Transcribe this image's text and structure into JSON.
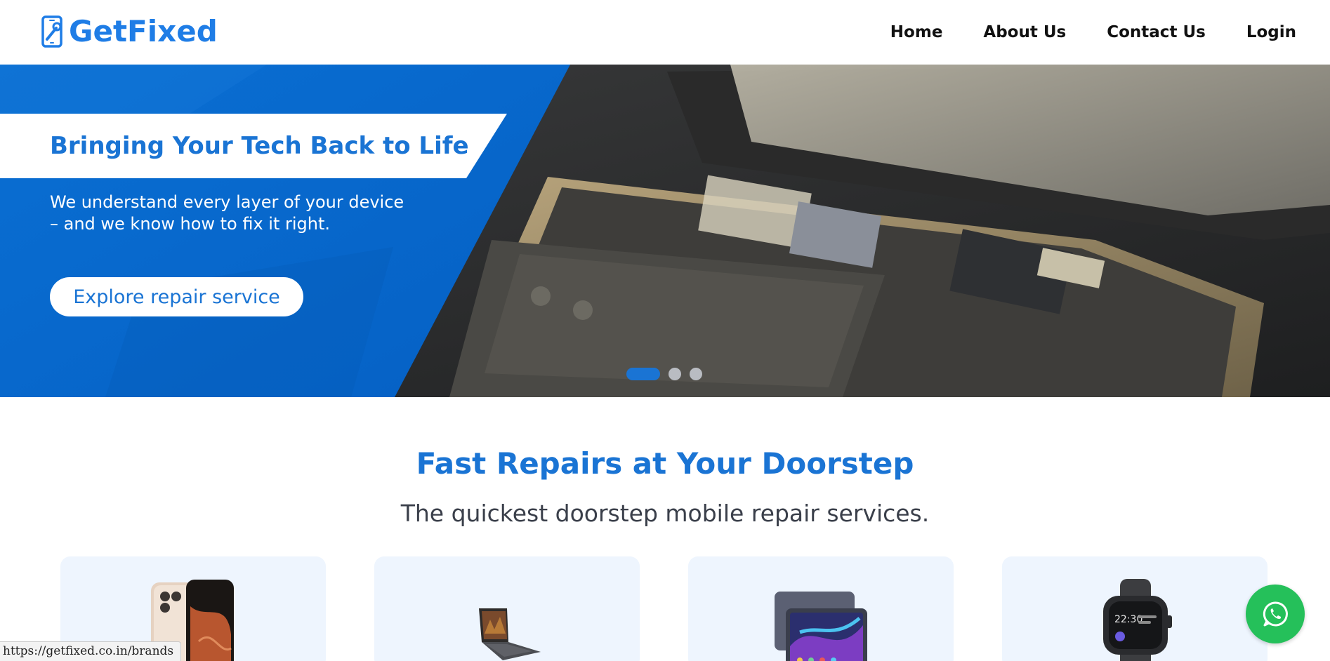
{
  "header": {
    "logo_text": "GetFixed",
    "nav": [
      {
        "label": "Home"
      },
      {
        "label": "About Us"
      },
      {
        "label": "Contact Us"
      },
      {
        "label": "Login"
      }
    ]
  },
  "hero": {
    "title": "Bringing Your Tech Back to Life",
    "subtitle": "We understand every layer of your device – and we know how to fix it right.",
    "button_label": "Explore repair service",
    "slides_total": 3,
    "active_slide": 1
  },
  "section": {
    "title": "Fast Repairs at Your Doorstep",
    "subtitle": "The quickest doorstep mobile repair services."
  },
  "cards": [
    {
      "icon": "smartphone-icon"
    },
    {
      "icon": "laptop-icon"
    },
    {
      "icon": "tablet-icon"
    },
    {
      "icon": "smartwatch-icon"
    }
  ],
  "status_bar": {
    "url": "https://getfixed.co.in/brands"
  },
  "colors": {
    "brand_blue": "#1a74d4",
    "whatsapp_green": "#25c05a",
    "card_bg": "#eef5fe"
  }
}
